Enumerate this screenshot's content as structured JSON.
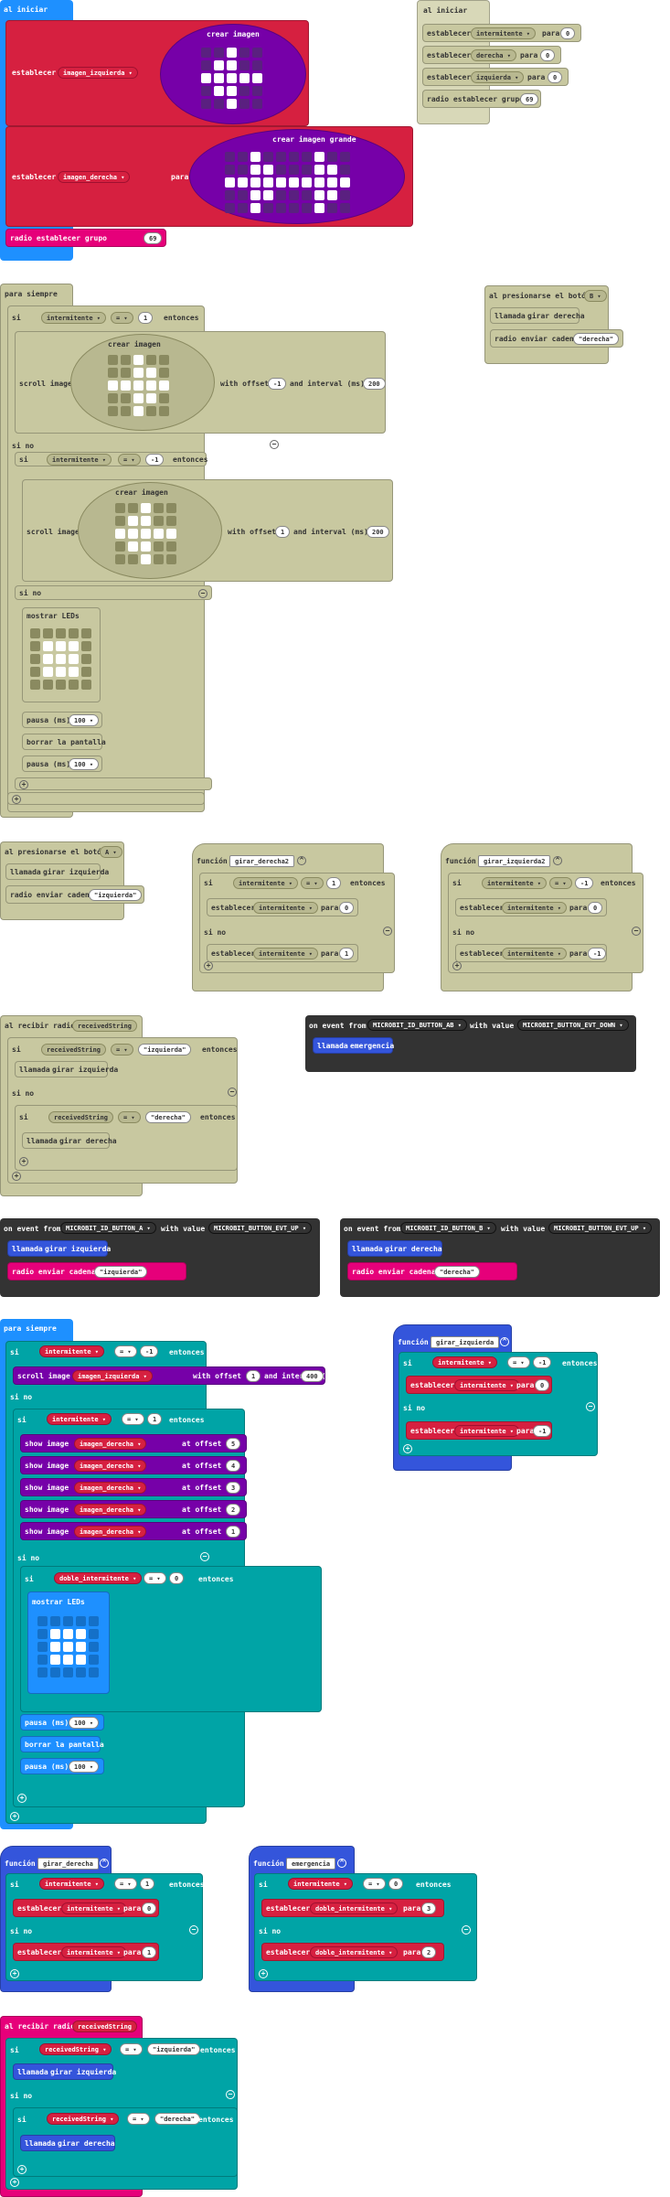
{
  "common": {
    "al_iniciar": "al iniciar",
    "para_siempre": "para siempre",
    "si": "si",
    "si_no": "si no",
    "entonces": "entonces",
    "establecer": "establecer",
    "para": "para",
    "a": "a",
    "llamada": "llamada",
    "funcion": "función",
    "al_recibir_radio": "al recibir radio",
    "al_presionarse_boton": "al presionarse el botón",
    "radio_enviar_cadena": "radio enviar cadena",
    "radio_establecer_grupo": "radio establecer grupo",
    "crear_imagen": "crear imagen",
    "crear_imagen_grande": "crear imagen grande",
    "scroll_image": "scroll image",
    "with_offset": "with offset",
    "and_interval_ms": "and interval (ms)",
    "mostrar_leds": "mostrar LEDs",
    "pausa_ms": "pausa (ms)",
    "borrar_pantalla": "borrar la pantalla",
    "show_image": "show image",
    "at_offset": "at offset",
    "on_event_from": "on event from",
    "with_value": "with value",
    "eq": "= ▾",
    "plus": "+",
    "minus": "−"
  },
  "vars": {
    "intermitente": "intermitente ▾",
    "imagen_izquierda": "imagen_izquierda ▾",
    "imagen_derecha": "imagen_derecha ▾",
    "derecha": "derecha ▾",
    "izquierda": "izquierda ▾",
    "doble_intermitente": "doble_intermitente ▾",
    "receivedString": "receivedString",
    "receivedString_dd": "receivedString ▾",
    "receivedString_plain": "receivedString"
  },
  "nums": {
    "n0": "0",
    "n1": "1",
    "n2": "2",
    "n3": "3",
    "n4": "4",
    "n5": "5",
    "nm1": "-1",
    "n69": "69",
    "n100": "100 ▾",
    "n200": "200",
    "n400": "400"
  },
  "strings": {
    "derecha": "\"derecha\"",
    "izquierda": "\"izquierda\""
  },
  "names": {
    "girar_derecha": "girar derecha",
    "girar_izquierda": "girar izquierda",
    "girar_derecha2": "girar_derecha2",
    "girar_izquierda2": "girar_izquierda2",
    "girar_derecha_id": "girar_derecha",
    "girar_izquierda_id": "girar_izquierda",
    "emergencia": "emergencia",
    "btn_B": "B ▾",
    "btn_A": "A ▾"
  },
  "events": {
    "ab": "MICROBIT_ID_BUTTON_AB ▾",
    "a": "MICROBIT_ID_BUTTON_A ▾",
    "b": "MICROBIT_ID_BUTTON_B ▾",
    "down": "MICROBIT_BUTTON_EVT_DOWN ▾",
    "up": "MICROBIT_BUTTON_EVT_UP ▾"
  },
  "images": {
    "left_arrow": [
      [
        0,
        0,
        1,
        0,
        0
      ],
      [
        0,
        1,
        1,
        0,
        0
      ],
      [
        1,
        1,
        1,
        1,
        1
      ],
      [
        0,
        1,
        1,
        0,
        0
      ],
      [
        0,
        0,
        1,
        0,
        0
      ]
    ],
    "double_right": [
      [
        0,
        0,
        1,
        0,
        0,
        0,
        0,
        1,
        0,
        0
      ],
      [
        0,
        0,
        1,
        1,
        0,
        0,
        0,
        1,
        1,
        0
      ],
      [
        1,
        1,
        1,
        1,
        1,
        1,
        1,
        1,
        1,
        1
      ],
      [
        0,
        0,
        1,
        1,
        0,
        0,
        0,
        1,
        1,
        0
      ],
      [
        0,
        0,
        1,
        0,
        0,
        0,
        0,
        1,
        0,
        0
      ]
    ],
    "right_arrow": [
      [
        0,
        0,
        1,
        0,
        0
      ],
      [
        0,
        0,
        1,
        1,
        0
      ],
      [
        1,
        1,
        1,
        1,
        1
      ],
      [
        0,
        0,
        1,
        1,
        0
      ],
      [
        0,
        0,
        1,
        0,
        0
      ]
    ],
    "left_arrow2": [
      [
        0,
        0,
        1,
        0,
        0
      ],
      [
        0,
        1,
        1,
        0,
        0
      ],
      [
        1,
        1,
        1,
        1,
        1
      ],
      [
        0,
        1,
        1,
        0,
        0
      ],
      [
        0,
        0,
        1,
        0,
        0
      ]
    ],
    "square": [
      [
        0,
        0,
        0,
        0,
        0
      ],
      [
        0,
        1,
        1,
        1,
        0
      ],
      [
        0,
        1,
        1,
        1,
        0
      ],
      [
        0,
        1,
        1,
        1,
        0
      ],
      [
        0,
        0,
        0,
        0,
        0
      ]
    ],
    "square2": [
      [
        0,
        0,
        0,
        0,
        0
      ],
      [
        0,
        1,
        1,
        1,
        0
      ],
      [
        0,
        1,
        1,
        1,
        0
      ],
      [
        0,
        1,
        1,
        1,
        0
      ],
      [
        0,
        0,
        0,
        0,
        0
      ]
    ]
  },
  "colors": {
    "blue": "#1e90ff",
    "red": "#d62040",
    "olive": "#c8c8a0",
    "purple": "#7600a8",
    "pink": "#e6007a",
    "teal": "#00a4a6",
    "dark": "#333333",
    "funcblue": "#3455db"
  }
}
